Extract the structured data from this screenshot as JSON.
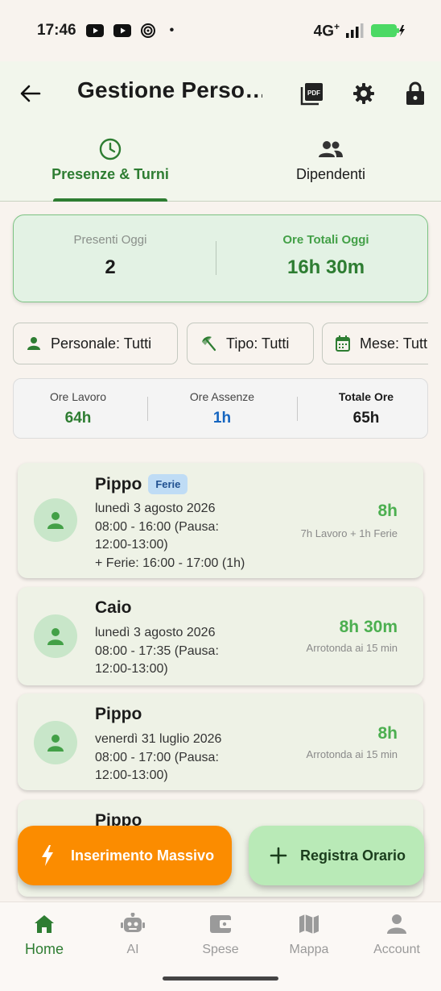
{
  "status_bar": {
    "time": "17:46",
    "network": "4G",
    "network_plus": "+",
    "dot": "•",
    "colors": {
      "battery": "#4cd964"
    }
  },
  "app_bar": {
    "back_icon": "arrow-left-icon",
    "title": "Gestione Perso…",
    "actions": [
      "pdf-icon",
      "gear-icon",
      "lock-icon"
    ]
  },
  "tabs": [
    {
      "label": "Presenze & Turni",
      "icon": "clock-icon",
      "active": true
    },
    {
      "label": "Dipendenti",
      "icon": "people-icon",
      "active": false
    }
  ],
  "summary": {
    "present_label": "Presenti Oggi",
    "present_value": "2",
    "total_label": "Ore Totali Oggi",
    "total_value": "16h 30m"
  },
  "filters": [
    {
      "label": "Personale: Tutti",
      "icon": "person-icon"
    },
    {
      "label": "Tipo: Tutti",
      "icon": "beach-umbrella-icon"
    },
    {
      "label": "Mese: Tutti",
      "icon": "calendar-icon"
    }
  ],
  "totals": {
    "work_label": "Ore Lavoro",
    "work_value": "64h",
    "absence_label": "Ore Assenze",
    "absence_value": "1h",
    "total_label": "Totale Ore",
    "total_value": "65h"
  },
  "entries": [
    {
      "name": "Pippo",
      "badge": "Ferie",
      "date": "lunedì 3 agosto 2026",
      "time_line1": "08:00 - 16:00 (Pausa:",
      "time_line2": "12:00-13:00)",
      "extra": "+ Ferie: 16:00 - 17:00 (1h)",
      "hours": "8h",
      "sub": "7h Lavoro + 1h Ferie"
    },
    {
      "name": "Caio",
      "date": "lunedì 3 agosto 2026",
      "time_line1": "08:00 - 17:35 (Pausa:",
      "time_line2": "12:00-13:00)",
      "hours": "8h 30m",
      "sub": "Arrotonda ai 15 min"
    },
    {
      "name": "Pippo",
      "date": "venerdì 31 luglio 2026",
      "time_line1": "08:00 - 17:00 (Pausa:",
      "time_line2": "12:00-13:00)",
      "hours": "8h",
      "sub": "Arrotonda ai 15 min"
    },
    {
      "name": "Pippo"
    }
  ],
  "fabs": {
    "bulk_label": "Inserimento Massivo",
    "bulk_icon": "lightning-icon",
    "register_label": "Registra Orario",
    "register_icon": "plus-icon"
  },
  "bottom_nav": [
    {
      "label": "Home",
      "icon": "home-icon",
      "active": true
    },
    {
      "label": "AI",
      "icon": "robot-icon",
      "active": false
    },
    {
      "label": "Spese",
      "icon": "wallet-icon",
      "active": false
    },
    {
      "label": "Mappa",
      "icon": "map-icon",
      "active": false
    },
    {
      "label": "Account",
      "icon": "account-icon",
      "active": false
    }
  ],
  "colors": {
    "primary": "#2e7d32",
    "accent_green": "#4caf50",
    "orange": "#fb8c00",
    "absence_blue": "#1565c0"
  }
}
